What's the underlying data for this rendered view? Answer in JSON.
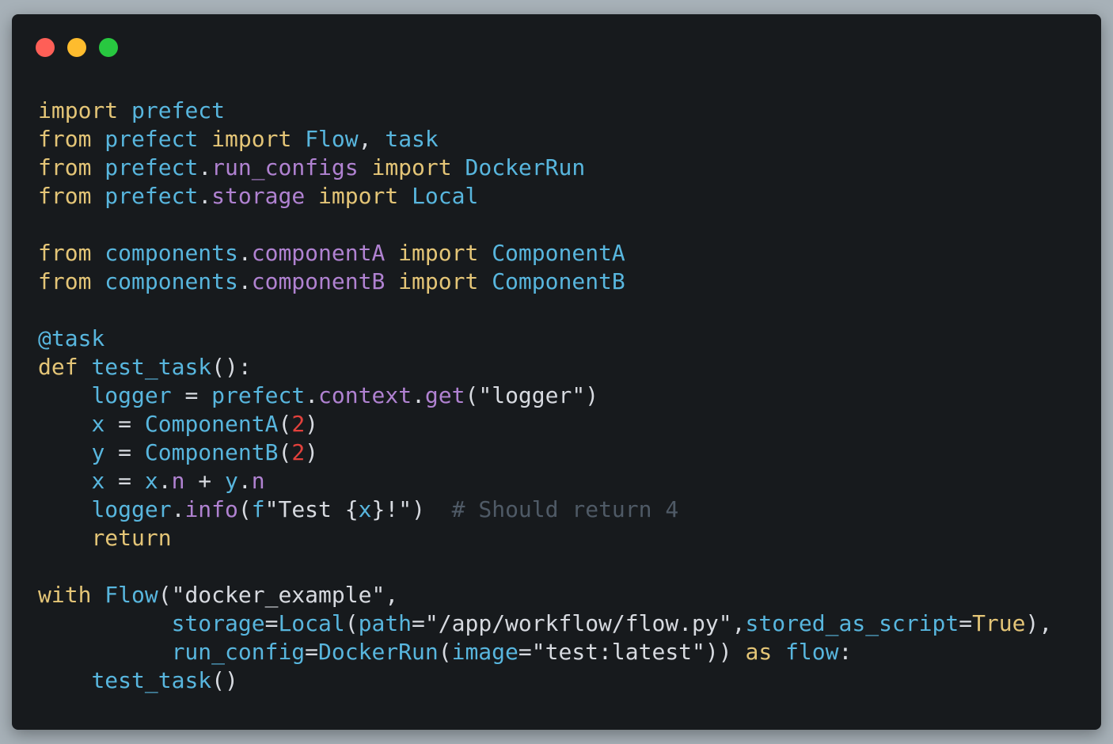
{
  "window": {
    "controls": [
      {
        "name": "close",
        "color": "#fe5f57"
      },
      {
        "name": "minimize",
        "color": "#febc2e"
      },
      {
        "name": "maximize",
        "color": "#28c840"
      }
    ]
  },
  "colors": {
    "keyword": "#e4c577",
    "identifier": "#58b6de",
    "attribute": "#b082d1",
    "plain": "#d7dae0",
    "string": "#d7dae0",
    "number": "#e2413c",
    "comment": "#4f5a66",
    "decorator": "#58b6de"
  },
  "code_lines": [
    [
      [
        "keyword",
        "import"
      ],
      [
        "plain",
        " "
      ],
      [
        "identifier",
        "prefect"
      ]
    ],
    [
      [
        "keyword",
        "from"
      ],
      [
        "plain",
        " "
      ],
      [
        "identifier",
        "prefect"
      ],
      [
        "plain",
        " "
      ],
      [
        "keyword",
        "import"
      ],
      [
        "plain",
        " "
      ],
      [
        "identifier",
        "Flow"
      ],
      [
        "plain",
        ", "
      ],
      [
        "identifier",
        "task"
      ]
    ],
    [
      [
        "keyword",
        "from"
      ],
      [
        "plain",
        " "
      ],
      [
        "identifier",
        "prefect"
      ],
      [
        "plain",
        "."
      ],
      [
        "attribute",
        "run_configs"
      ],
      [
        "plain",
        " "
      ],
      [
        "keyword",
        "import"
      ],
      [
        "plain",
        " "
      ],
      [
        "identifier",
        "DockerRun"
      ]
    ],
    [
      [
        "keyword",
        "from"
      ],
      [
        "plain",
        " "
      ],
      [
        "identifier",
        "prefect"
      ],
      [
        "plain",
        "."
      ],
      [
        "attribute",
        "storage"
      ],
      [
        "plain",
        " "
      ],
      [
        "keyword",
        "import"
      ],
      [
        "plain",
        " "
      ],
      [
        "identifier",
        "Local"
      ]
    ],
    [],
    [
      [
        "keyword",
        "from"
      ],
      [
        "plain",
        " "
      ],
      [
        "identifier",
        "components"
      ],
      [
        "plain",
        "."
      ],
      [
        "attribute",
        "componentA"
      ],
      [
        "plain",
        " "
      ],
      [
        "keyword",
        "import"
      ],
      [
        "plain",
        " "
      ],
      [
        "identifier",
        "ComponentA"
      ]
    ],
    [
      [
        "keyword",
        "from"
      ],
      [
        "plain",
        " "
      ],
      [
        "identifier",
        "components"
      ],
      [
        "plain",
        "."
      ],
      [
        "attribute",
        "componentB"
      ],
      [
        "plain",
        " "
      ],
      [
        "keyword",
        "import"
      ],
      [
        "plain",
        " "
      ],
      [
        "identifier",
        "ComponentB"
      ]
    ],
    [],
    [
      [
        "decorator",
        "@task"
      ]
    ],
    [
      [
        "keyword",
        "def"
      ],
      [
        "plain",
        " "
      ],
      [
        "identifier",
        "test_task"
      ],
      [
        "plain",
        "():"
      ]
    ],
    [
      [
        "plain",
        "    "
      ],
      [
        "identifier",
        "logger"
      ],
      [
        "plain",
        " = "
      ],
      [
        "identifier",
        "prefect"
      ],
      [
        "plain",
        "."
      ],
      [
        "attribute",
        "context"
      ],
      [
        "plain",
        "."
      ],
      [
        "attribute",
        "get"
      ],
      [
        "plain",
        "("
      ],
      [
        "string",
        "\"logger\""
      ],
      [
        "plain",
        ")"
      ]
    ],
    [
      [
        "plain",
        "    "
      ],
      [
        "identifier",
        "x"
      ],
      [
        "plain",
        " = "
      ],
      [
        "identifier",
        "ComponentA"
      ],
      [
        "plain",
        "("
      ],
      [
        "number",
        "2"
      ],
      [
        "plain",
        ")"
      ]
    ],
    [
      [
        "plain",
        "    "
      ],
      [
        "identifier",
        "y"
      ],
      [
        "plain",
        " = "
      ],
      [
        "identifier",
        "ComponentB"
      ],
      [
        "plain",
        "("
      ],
      [
        "number",
        "2"
      ],
      [
        "plain",
        ")"
      ]
    ],
    [
      [
        "plain",
        "    "
      ],
      [
        "identifier",
        "x"
      ],
      [
        "plain",
        " = "
      ],
      [
        "identifier",
        "x"
      ],
      [
        "plain",
        "."
      ],
      [
        "attribute",
        "n"
      ],
      [
        "plain",
        " + "
      ],
      [
        "identifier",
        "y"
      ],
      [
        "plain",
        "."
      ],
      [
        "attribute",
        "n"
      ]
    ],
    [
      [
        "plain",
        "    "
      ],
      [
        "identifier",
        "logger"
      ],
      [
        "plain",
        "."
      ],
      [
        "attribute",
        "info"
      ],
      [
        "plain",
        "("
      ],
      [
        "identifier",
        "f"
      ],
      [
        "string",
        "\"Test {"
      ],
      [
        "identifier",
        "x"
      ],
      [
        "string",
        "}!\""
      ],
      [
        "plain",
        ")  "
      ],
      [
        "comment",
        "# Should return 4"
      ]
    ],
    [
      [
        "plain",
        "    "
      ],
      [
        "keyword",
        "return"
      ]
    ],
    [],
    [
      [
        "keyword",
        "with"
      ],
      [
        "plain",
        " "
      ],
      [
        "identifier",
        "Flow"
      ],
      [
        "plain",
        "("
      ],
      [
        "string",
        "\"docker_example\""
      ],
      [
        "plain",
        ","
      ]
    ],
    [
      [
        "plain",
        "          "
      ],
      [
        "identifier",
        "storage"
      ],
      [
        "plain",
        "="
      ],
      [
        "identifier",
        "Local"
      ],
      [
        "plain",
        "("
      ],
      [
        "identifier",
        "path"
      ],
      [
        "plain",
        "="
      ],
      [
        "string",
        "\"/app/workflow/flow.py\""
      ],
      [
        "plain",
        ","
      ],
      [
        "identifier",
        "stored_as_script"
      ],
      [
        "plain",
        "="
      ],
      [
        "keyword",
        "True"
      ],
      [
        "plain",
        "),"
      ]
    ],
    [
      [
        "plain",
        "          "
      ],
      [
        "identifier",
        "run_config"
      ],
      [
        "plain",
        "="
      ],
      [
        "identifier",
        "DockerRun"
      ],
      [
        "plain",
        "("
      ],
      [
        "identifier",
        "image"
      ],
      [
        "plain",
        "="
      ],
      [
        "string",
        "\"test:latest\""
      ],
      [
        "plain",
        ")) "
      ],
      [
        "keyword",
        "as"
      ],
      [
        "plain",
        " "
      ],
      [
        "identifier",
        "flow"
      ],
      [
        "plain",
        ":"
      ]
    ],
    [
      [
        "plain",
        "    "
      ],
      [
        "identifier",
        "test_task"
      ],
      [
        "plain",
        "()"
      ]
    ]
  ]
}
